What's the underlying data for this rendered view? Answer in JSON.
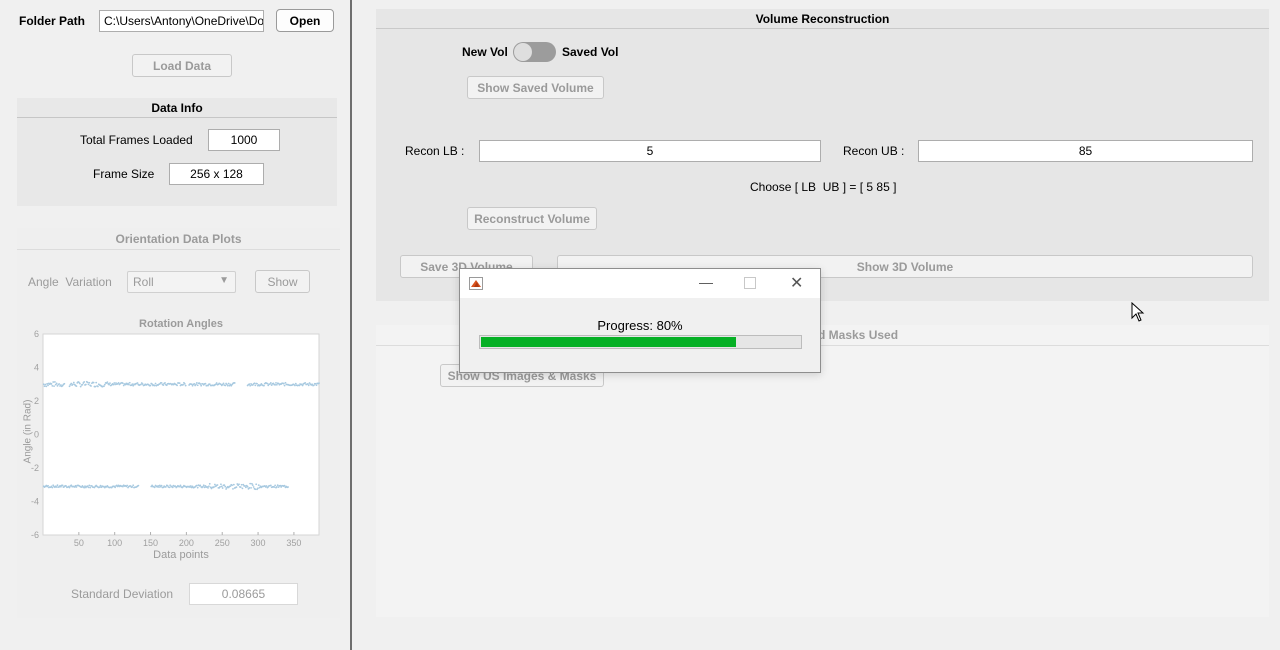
{
  "left": {
    "folder_label": "Folder Path",
    "folder_value": "C:\\Users\\Antony\\OneDrive\\Do",
    "open_label": "Open",
    "load_label": "Load Data",
    "data_info": {
      "title": "Data Info",
      "frames_label": "Total Frames Loaded",
      "frames_value": "1000",
      "size_label": "Frame Size",
      "size_value": "256 x 128"
    },
    "orientation": {
      "title": "Orientation Data Plots",
      "angle_label": "Angle  Variation",
      "select_value": "Roll",
      "show_label": "Show",
      "std_label": "Standard Deviation",
      "std_value": "0.08665"
    }
  },
  "right": {
    "vol_title": "Volume Reconstruction",
    "toggle_off": "New Vol",
    "toggle_on": "Saved Vol",
    "show_saved": "Show Saved Volume",
    "lb_label": "Recon LB :",
    "lb_value": "5",
    "ub_label": "Recon UB :",
    "ub_value": "85",
    "choose_text": "Choose [ LB  UB ] = [ 5 85 ]",
    "reconstruct": "Reconstruct Volume",
    "save3d": "Save 3D Volume",
    "show3d": "Show 3D Volume",
    "masks_title_visible": "d Masks Used",
    "show_us": "Show US Images & Masks"
  },
  "dialog": {
    "progress_text": "Progress: 80%",
    "progress": 0.8
  },
  "chart_data": {
    "type": "scatter",
    "title": "Rotation Angles",
    "xlabel": "Data points",
    "ylabel": "Angle (in Rad)",
    "xlim": [
      0,
      385
    ],
    "ylim": [
      -6,
      6
    ],
    "xticks": [
      "50",
      "100",
      "150",
      "200",
      "250",
      "300",
      "350"
    ],
    "yticks": [
      "6",
      "4",
      "2",
      "0",
      "-2",
      "-4",
      "-6"
    ],
    "series": [
      {
        "points_upper_y": 3.0,
        "points_lower_y": -3.1
      }
    ]
  },
  "colors": {
    "progress": "#06b025",
    "scatter": "#a7c9e0"
  }
}
